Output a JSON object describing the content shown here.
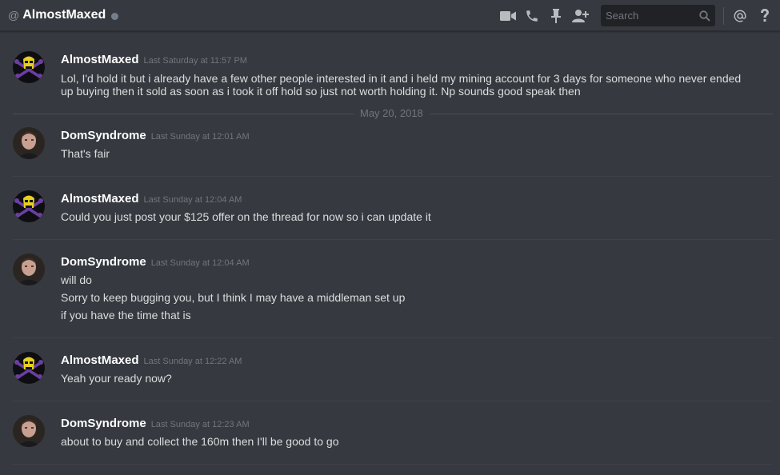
{
  "header": {
    "at_symbol": "@",
    "title": "AlmostMaxed",
    "status_color": "#747f8d",
    "icons": [
      "video-call-icon",
      "voice-call-icon",
      "pin-icon",
      "add-user-icon",
      "mention-icon",
      "help-icon"
    ],
    "search": {
      "placeholder": "Search",
      "value": ""
    }
  },
  "date_divider": "May 20, 2018",
  "messages": [
    {
      "author": "AlmostMaxed",
      "timestamp": "Last Saturday at 11:57 PM",
      "lines": [
        "Lol, I'd hold it but i already have a few other people interested in it and i held my mining account for 3 days for someone who never ended up buying then it sold as soon as i took it off hold so just not worth holding it. Np sounds good speak then"
      ]
    },
    {
      "author": "DomSyndrome",
      "timestamp": "Last Sunday at 12:01 AM",
      "lines": [
        "That's fair"
      ]
    },
    {
      "author": "AlmostMaxed",
      "timestamp": "Last Sunday at 12:04 AM",
      "lines": [
        "Could you just post your $125 offer on the thread for now so i can update it"
      ]
    },
    {
      "author": "DomSyndrome",
      "timestamp": "Last Sunday at 12:04 AM",
      "lines": [
        "will do",
        "Sorry to keep bugging you, but I think I may have a middleman set up",
        "if you have the time that is"
      ]
    },
    {
      "author": "AlmostMaxed",
      "timestamp": "Last Sunday at 12:22 AM",
      "lines": [
        "Yeah your ready now?"
      ]
    },
    {
      "author": "DomSyndrome",
      "timestamp": "Last Sunday at 12:23 AM",
      "lines": [
        "about to buy and collect the 160m then I'll be good to go"
      ]
    }
  ]
}
